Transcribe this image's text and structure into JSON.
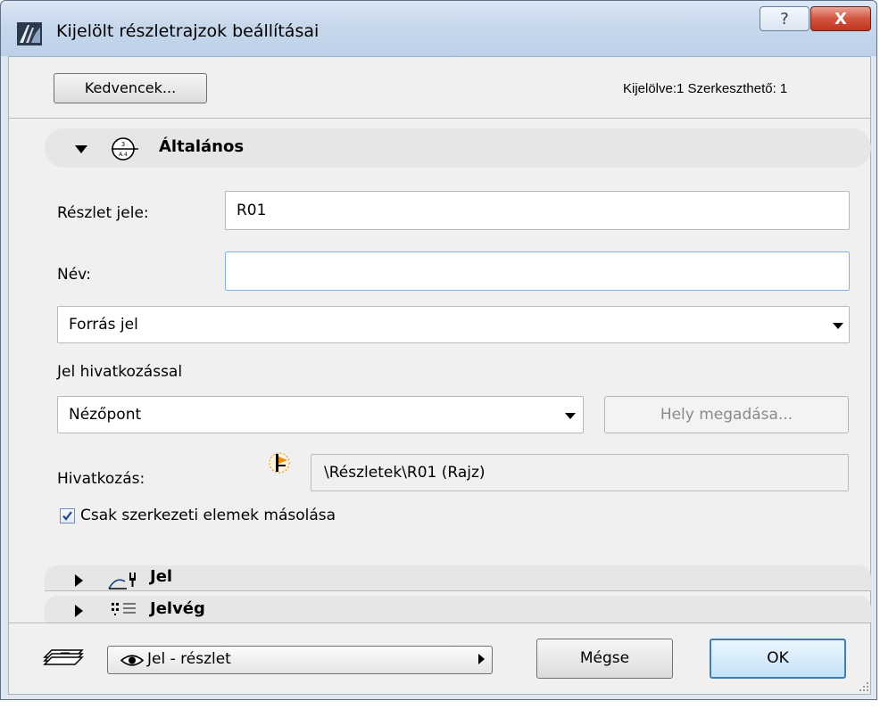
{
  "window": {
    "title": "Kijelölt részletrajzok beállításai",
    "help_label": "?",
    "close_label": "X"
  },
  "toolbar": {
    "favorites_label": "Kedvencek...",
    "selection_status": "Kijelölve:1 Szerkeszthető: 1"
  },
  "sections": {
    "general": {
      "title": "Általános",
      "expanded": true
    },
    "marker": {
      "title": "Jel",
      "expanded": false
    },
    "marker_end": {
      "title": "Jelvég",
      "expanded": false
    }
  },
  "general": {
    "detail_id_label": "Részlet jele:",
    "detail_id_value": "R01",
    "name_label": "Név:",
    "name_value": "",
    "source_select_value": "Forrás jel",
    "reference_marker_label": "Jel hivatkozással",
    "viewpoint_select_value": "Nézőpont",
    "set_location_button": "Hely megadása...",
    "reference_label": "Hivatkozás:",
    "reference_value": "\\Részletek\\R01 (Rajz)",
    "copy_structural_label": "Csak szerkezeti elemek másolása",
    "copy_structural_checked": true
  },
  "footer": {
    "layer_value": "Jel - részlet",
    "cancel_label": "Mégse",
    "ok_label": "OK"
  },
  "colors": {
    "window_frame": "#dfe6ee",
    "title_gradient_top": "#dbe7f4",
    "close_red": "#c0341f",
    "content_bg": "#f0f0f0",
    "focus_border": "#7eb4ea",
    "ok_border": "#3c7fb1"
  }
}
